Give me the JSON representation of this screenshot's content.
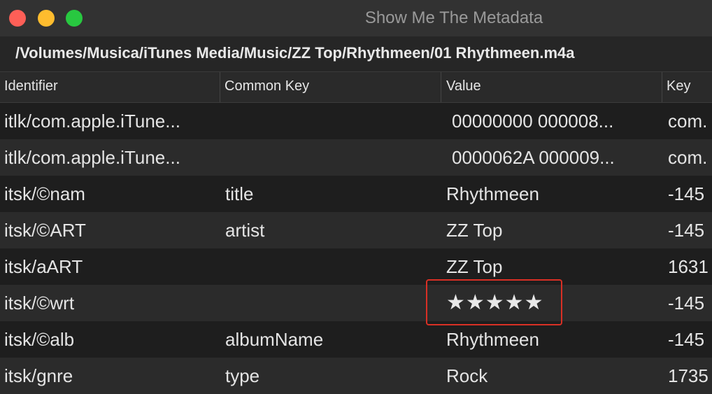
{
  "window": {
    "title": "Show Me The Metadata",
    "path": "/Volumes/Musica/iTunes Media/Music/ZZ Top/Rhythmeen/01 Rhythmeen.m4a"
  },
  "table": {
    "columns": [
      "Identifier",
      "Common Key",
      "Value",
      "Key"
    ],
    "rows": [
      {
        "identifier": "itlk/com.apple.iTune...",
        "common_key": "",
        "value": "00000000 000008...",
        "key": "com."
      },
      {
        "identifier": "itlk/com.apple.iTune...",
        "common_key": "",
        "value": "0000062A 000009...",
        "key": "com."
      },
      {
        "identifier": "itsk/©nam",
        "common_key": "title",
        "value": "Rhythmeen",
        "key": "-145"
      },
      {
        "identifier": "itsk/©ART",
        "common_key": "artist",
        "value": "ZZ Top",
        "key": "-145"
      },
      {
        "identifier": "itsk/aART",
        "common_key": "",
        "value": "ZZ Top",
        "key": "1631"
      },
      {
        "identifier": "itsk/©wrt",
        "common_key": "",
        "value": "★★★★★",
        "key": "-145"
      },
      {
        "identifier": "itsk/©alb",
        "common_key": "albumName",
        "value": "Rhythmeen",
        "key": "-145"
      },
      {
        "identifier": "itsk/gnre",
        "common_key": "type",
        "value": "Rock",
        "key": "1735"
      }
    ]
  },
  "colors": {
    "highlight": "#d93025",
    "close": "#fe5f57",
    "minimize": "#febc2e",
    "maximize": "#28c840"
  }
}
